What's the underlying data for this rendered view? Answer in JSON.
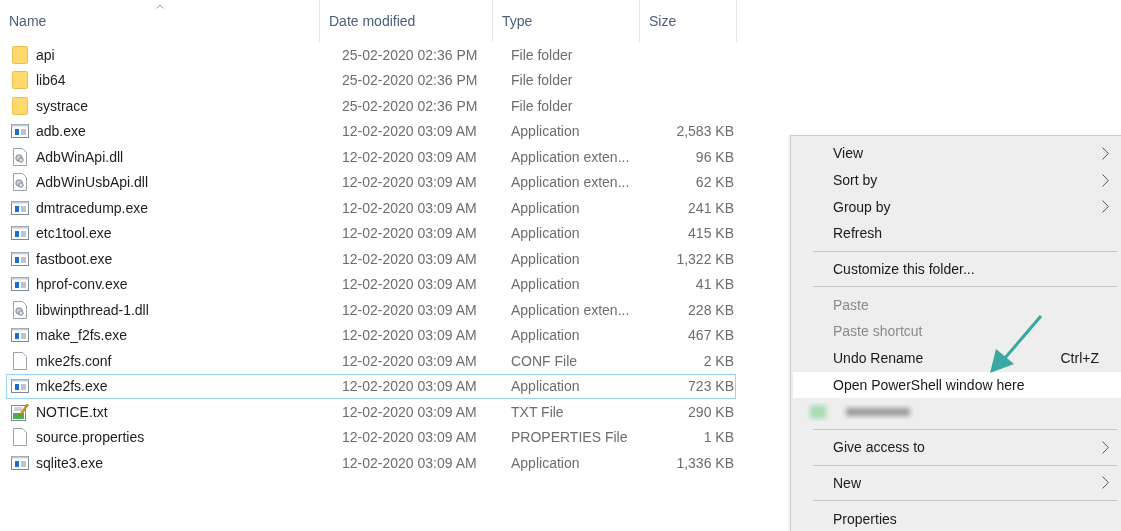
{
  "columns": [
    {
      "label": "Name",
      "sorted": true
    },
    {
      "label": "Date modified",
      "sorted": false
    },
    {
      "label": "Type",
      "sorted": false
    },
    {
      "label": "Size",
      "sorted": false
    }
  ],
  "rows": [
    {
      "kind": "folder",
      "name": "api",
      "date": "25-02-2020 02:36 PM",
      "type": "File folder",
      "selected": false
    },
    {
      "kind": "folder",
      "name": "lib64",
      "date": "25-02-2020 02:36 PM",
      "type": "File folder",
      "selected": false
    },
    {
      "kind": "folder",
      "name": "systrace",
      "date": "25-02-2020 02:36 PM",
      "type": "File folder",
      "selected": false
    },
    {
      "kind": "exe",
      "name": "adb.exe",
      "date": "12-02-2020 03:09 AM",
      "type": "Application",
      "size": "2,583 KB",
      "selected": false
    },
    {
      "kind": "dll",
      "name": "AdbWinApi.dll",
      "date": "12-02-2020 03:09 AM",
      "type": "Application exten...",
      "size": "96 KB",
      "selected": false
    },
    {
      "kind": "dll",
      "name": "AdbWinUsbApi.dll",
      "date": "12-02-2020 03:09 AM",
      "type": "Application exten...",
      "size": "62 KB",
      "selected": false
    },
    {
      "kind": "exe",
      "name": "dmtracedump.exe",
      "date": "12-02-2020 03:09 AM",
      "type": "Application",
      "size": "241 KB",
      "selected": false
    },
    {
      "kind": "exe",
      "name": "etc1tool.exe",
      "date": "12-02-2020 03:09 AM",
      "type": "Application",
      "size": "415 KB",
      "selected": false
    },
    {
      "kind": "exe",
      "name": "fastboot.exe",
      "date": "12-02-2020 03:09 AM",
      "type": "Application",
      "size": "1,322 KB",
      "selected": false
    },
    {
      "kind": "exe",
      "name": "hprof-conv.exe",
      "date": "12-02-2020 03:09 AM",
      "type": "Application",
      "size": "41 KB",
      "selected": false
    },
    {
      "kind": "dll",
      "name": "libwinpthread-1.dll",
      "date": "12-02-2020 03:09 AM",
      "type": "Application exten...",
      "size": "228 KB",
      "selected": false
    },
    {
      "kind": "exe",
      "name": "make_f2fs.exe",
      "date": "12-02-2020 03:09 AM",
      "type": "Application",
      "size": "467 KB",
      "selected": false
    },
    {
      "kind": "file",
      "name": "mke2fs.conf",
      "date": "12-02-2020 03:09 AM",
      "type": "CONF File",
      "size": "2 KB",
      "selected": false
    },
    {
      "kind": "exe",
      "name": "mke2fs.exe",
      "date": "12-02-2020 03:09 AM",
      "type": "Application",
      "size": "723 KB",
      "selected": true
    },
    {
      "kind": "txt",
      "name": "NOTICE.txt",
      "date": "12-02-2020 03:09 AM",
      "type": "TXT File",
      "size": "290 KB",
      "selected": false
    },
    {
      "kind": "file",
      "name": "source.properties",
      "date": "12-02-2020 03:09 AM",
      "type": "PROPERTIES File",
      "size": "1 KB",
      "selected": false
    },
    {
      "kind": "exe",
      "name": "sqlite3.exe",
      "date": "12-02-2020 03:09 AM",
      "type": "Application",
      "size": "1,336 KB",
      "selected": false
    }
  ],
  "context_menu": {
    "items": [
      {
        "kind": "item",
        "label": "View",
        "submenu": true,
        "disabled": false,
        "selected": false
      },
      {
        "kind": "item",
        "label": "Sort by",
        "submenu": true,
        "disabled": false,
        "selected": false
      },
      {
        "kind": "item",
        "label": "Group by",
        "submenu": true,
        "disabled": false,
        "selected": false
      },
      {
        "kind": "item",
        "label": "Refresh",
        "submenu": false,
        "disabled": false,
        "selected": false
      },
      {
        "kind": "separator"
      },
      {
        "kind": "item",
        "label": "Customize this folder...",
        "submenu": false,
        "disabled": false,
        "selected": false
      },
      {
        "kind": "separator"
      },
      {
        "kind": "item",
        "label": "Paste",
        "submenu": false,
        "disabled": true,
        "selected": false
      },
      {
        "kind": "item",
        "label": "Paste shortcut",
        "submenu": false,
        "disabled": true,
        "selected": false
      },
      {
        "kind": "item",
        "label": "Undo Rename",
        "shortcut": "Ctrl+Z",
        "submenu": false,
        "disabled": false,
        "selected": false
      },
      {
        "kind": "item",
        "label": "Open PowerShell window here",
        "submenu": false,
        "disabled": false,
        "selected": true
      },
      {
        "kind": "redacted"
      },
      {
        "kind": "separator"
      },
      {
        "kind": "item",
        "label": "Give access to",
        "submenu": true,
        "disabled": false,
        "selected": false
      },
      {
        "kind": "separator"
      },
      {
        "kind": "item",
        "label": "New",
        "submenu": true,
        "disabled": false,
        "selected": false
      },
      {
        "kind": "separator"
      },
      {
        "kind": "item",
        "label": "Properties",
        "submenu": false,
        "disabled": false,
        "selected": false
      }
    ]
  }
}
